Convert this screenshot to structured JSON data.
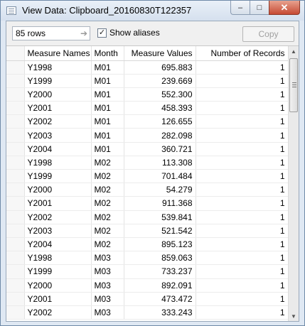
{
  "window": {
    "title": "View Data:  Clipboard_20160830T122357",
    "minimize_glyph": "–",
    "maximize_glyph": "□",
    "close_glyph": "✕"
  },
  "toolbar": {
    "rows_count": "85 rows",
    "rows_arrow": "➔",
    "show_aliases_label": "Show aliases",
    "show_aliases_checked": true,
    "check_glyph": "✓",
    "copy_label": "Copy"
  },
  "grid": {
    "columns": [
      "Measure Names",
      "Month",
      "Measure Values",
      "Number of Records"
    ],
    "rows": [
      [
        "Y1998",
        "M01",
        "695.883",
        "1"
      ],
      [
        "Y1999",
        "M01",
        "239.669",
        "1"
      ],
      [
        "Y2000",
        "M01",
        "552.300",
        "1"
      ],
      [
        "Y2001",
        "M01",
        "458.393",
        "1"
      ],
      [
        "Y2002",
        "M01",
        "126.655",
        "1"
      ],
      [
        "Y2003",
        "M01",
        "282.098",
        "1"
      ],
      [
        "Y2004",
        "M01",
        "360.721",
        "1"
      ],
      [
        "Y1998",
        "M02",
        "113.308",
        "1"
      ],
      [
        "Y1999",
        "M02",
        "701.484",
        "1"
      ],
      [
        "Y2000",
        "M02",
        "54.279",
        "1"
      ],
      [
        "Y2001",
        "M02",
        "911.368",
        "1"
      ],
      [
        "Y2002",
        "M02",
        "539.841",
        "1"
      ],
      [
        "Y2003",
        "M02",
        "521.542",
        "1"
      ],
      [
        "Y2004",
        "M02",
        "895.123",
        "1"
      ],
      [
        "Y1998",
        "M03",
        "859.063",
        "1"
      ],
      [
        "Y1999",
        "M03",
        "733.237",
        "1"
      ],
      [
        "Y2000",
        "M03",
        "892.091",
        "1"
      ],
      [
        "Y2001",
        "M03",
        "473.472",
        "1"
      ],
      [
        "Y2002",
        "M03",
        "333.243",
        "1"
      ]
    ]
  },
  "scrollbar": {
    "up_glyph": "▲",
    "down_glyph": "▼"
  }
}
